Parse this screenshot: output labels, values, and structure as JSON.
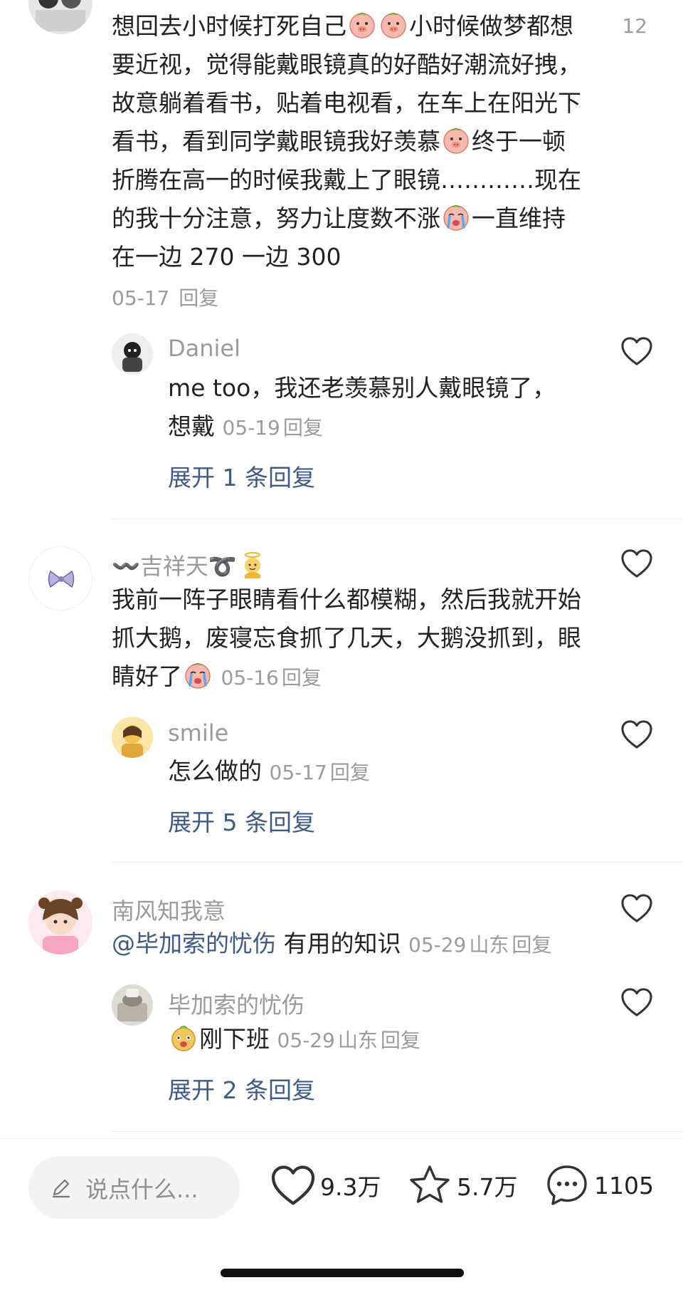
{
  "comments": [
    {
      "text_1": "想回去小时候打死自己",
      "text_2": "小时候做梦都想要近视，觉得能戴眼镜真的好酷好潮流好拽，故意躺着看书，贴着电视看，在车上在阳光下看书，看到同学戴眼镜我好羡慕",
      "text_3": "终于一顿折腾在高一的时候我戴上了眼镜…………现在的我十分注意，努力让度数不涨",
      "text_4": "一直维持在一边 270 一边 300",
      "date": "05-17",
      "reply_label": "回复",
      "like_count": "12",
      "emojis": [
        "pig-face-emoji",
        "pig-face-emoji",
        "pig-face-emoji",
        "crying-face-emoji"
      ],
      "replies": [
        {
          "name": "Daniel",
          "text": "me too，我还老羡慕别人戴眼镜了，想戴",
          "date": "05-19",
          "reply_label": "回复"
        }
      ],
      "expand_label": "展开 1 条回复"
    },
    {
      "name_prefix": "〰️",
      "name": "吉祥天",
      "name_suffix": "➰",
      "name_emoji": "angel-emoji",
      "text": "我前一阵子眼睛看什么都模糊，然后我就开始抓大鹅，废寝忘食抓了几天，大鹅没抓到，眼睛好了",
      "text_emoji": "crying-face-emoji",
      "date": "05-16",
      "reply_label": "回复",
      "replies": [
        {
          "name": "smile",
          "text": "怎么做的",
          "date": "05-17",
          "reply_label": "回复"
        }
      ],
      "expand_label": "展开 5 条回复"
    },
    {
      "name": "南风知我意",
      "mention": "@毕加索的忧伤",
      "text": "有用的知识",
      "date": "05-29",
      "location": "山东",
      "reply_label": "回复",
      "replies": [
        {
          "name": "毕加索的忧伤",
          "text": "刚下班",
          "text_emoji": "dog-face-emoji",
          "date": "05-29",
          "location": "山东",
          "reply_label": "回复"
        }
      ],
      "expand_label": "展开 2 条回复"
    }
  ],
  "bottom_bar": {
    "input_placeholder": "说点什么...",
    "likes": "9.3万",
    "favorites": "5.7万",
    "comments": "1105"
  },
  "colors": {
    "link": "#3e5a86",
    "meta": "#9b9b9b",
    "name": "#9a9a9a",
    "text": "#222222"
  }
}
